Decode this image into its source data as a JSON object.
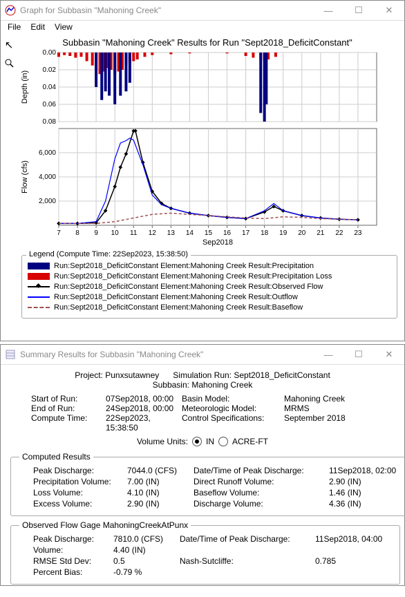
{
  "graph_window": {
    "title": "Graph for Subbasin \"Mahoning Creek\"",
    "menu": {
      "file": "File",
      "edit": "Edit",
      "view": "View"
    },
    "chart_title": "Subbasin \"Mahoning Creek\" Results for Run \"Sept2018_DeficitConstant\"",
    "y1_label": "Depth (in)",
    "y2_label": "Flow (cfs)",
    "x_label": "Sep2018",
    "legend_title": "Legend (Compute Time: 22Sep2023, 15:38:50)",
    "legend": {
      "precip": "Run:Sept2018_DeficitConstant Element:Mahoning Creek Result:Precipitation",
      "precip_loss": "Run:Sept2018_DeficitConstant Element:Mahoning Creek Result:Precipitation Loss",
      "observed": "Run:Sept2018_DeficitConstant Element:Mahoning Creek Result:Observed Flow",
      "outflow": "Run:Sept2018_DeficitConstant Element:Mahoning Creek Result:Outflow",
      "baseflow": "Run:Sept2018_DeficitConstant Element:Mahoning Creek Result:Baseflow"
    }
  },
  "summary_window": {
    "title": "Summary Results for Subbasin \"Mahoning Creek\"",
    "project_lbl": "Project:",
    "project": "Punxsutawney",
    "simrun_lbl": "Simulation Run:",
    "simrun": "Sept2018_DeficitConstant",
    "subbasin_lbl": "Subbasin:",
    "subbasin": "Mahoning Creek",
    "start_lbl": "Start of Run:",
    "start": "07Sep2018, 00:00",
    "end_lbl": "End of Run:",
    "end": "24Sep2018, 00:00",
    "ctime_lbl": "Compute Time:",
    "ctime": "22Sep2023, 15:38:50",
    "basin_lbl": "Basin Model:",
    "basin": "Mahoning Creek",
    "met_lbl": "Meteorologic Model:",
    "met": "MRMS",
    "ctrl_lbl": "Control Specifications:",
    "ctrl": "September 2018",
    "vol_label": "Volume Units:",
    "vol_in": "IN",
    "vol_acft": "ACRE-FT",
    "computed_title": "Computed Results",
    "observed_title": "Observed Flow Gage MahoningCreekAtPunx",
    "computed": {
      "peak_lbl": "Peak Discharge:",
      "peak": "7044.0 (CFS)",
      "pvol_lbl": "Precipitation Volume:",
      "pvol": "7.00 (IN)",
      "loss_lbl": "Loss Volume:",
      "loss": "4.10 (IN)",
      "excess_lbl": "Excess Volume:",
      "excess": "2.90 (IN)",
      "dtp_lbl": "Date/Time of Peak Discharge:",
      "dtp": "11Sep2018, 02:00",
      "dro_lbl": "Direct Runoff Volume:",
      "dro": "2.90 (IN)",
      "bfv_lbl": "Baseflow Volume:",
      "bfv": "1.46 (IN)",
      "dv_lbl": "Discharge Volume:",
      "dv": "4.36 (IN)"
    },
    "observed": {
      "peak_lbl": "Peak Discharge:",
      "peak": "7810.0 (CFS)",
      "vol_lbl": "Volume:",
      "vol": "4.40 (IN)",
      "rmse_lbl": "RMSE Std Dev:",
      "rmse": "0.5",
      "pb_lbl": "Percent Bias:",
      "pb": "-0.79 %",
      "dtp_lbl": "Date/Time of Peak Discharge:",
      "dtp": "11Sep2018, 04:00",
      "ns_lbl": "Nash-Sutcliffe:",
      "ns": "0.785"
    }
  },
  "chart_data": [
    {
      "type": "bar",
      "title": "Precipitation / Loss (inverted)",
      "xlabel": "Sep2018",
      "ylabel": "Depth (in)",
      "ylim": [
        0,
        0.08
      ],
      "y_ticks": [
        0.0,
        0.02,
        0.04,
        0.06,
        0.08
      ],
      "x_ticks": [
        7,
        8,
        9,
        10,
        11,
        12,
        13,
        14,
        15,
        16,
        17,
        18,
        19,
        20,
        21,
        22,
        23
      ],
      "series": [
        {
          "name": "Precipitation Loss",
          "color": "#d80000",
          "x": [
            7.0,
            7.3,
            7.6,
            7.9,
            8.2,
            8.5,
            8.8,
            9.0,
            9.2,
            9.4,
            9.6,
            9.8,
            10.0,
            10.2,
            10.4,
            10.6,
            10.8,
            11.0,
            11.2,
            11.6,
            12.0,
            13.0,
            14.0,
            16.0,
            17.0,
            17.4,
            17.8,
            18.0,
            18.2,
            18.6
          ],
          "values": [
            0.005,
            0.003,
            0.004,
            0.006,
            0.005,
            0.01,
            0.015,
            0.02,
            0.025,
            0.022,
            0.018,
            0.02,
            0.025,
            0.022,
            0.02,
            0.015,
            0.012,
            0.01,
            0.008,
            0.005,
            0.003,
            0.002,
            0.001,
            0.001,
            0.004,
            0.006,
            0.008,
            0.01,
            0.008,
            0.005
          ]
        },
        {
          "name": "Precipitation",
          "color": "#000080",
          "x": [
            9.0,
            9.3,
            9.5,
            9.7,
            10.0,
            10.3,
            10.6,
            10.8,
            17.8,
            18.0,
            18.1
          ],
          "values": [
            0.04,
            0.055,
            0.045,
            0.05,
            0.06,
            0.05,
            0.045,
            0.035,
            0.07,
            0.08,
            0.06
          ]
        }
      ]
    },
    {
      "type": "line",
      "title": "Flow",
      "xlabel": "Sep2018",
      "ylabel": "Flow (cfs)",
      "ylim": [
        0,
        8000
      ],
      "y_ticks": [
        2000,
        4000,
        6000
      ],
      "x_ticks": [
        7,
        8,
        9,
        10,
        11,
        12,
        13,
        14,
        15,
        16,
        17,
        18,
        19,
        20,
        21,
        22,
        23
      ],
      "series": [
        {
          "name": "Observed Flow",
          "color": "#000000",
          "x": [
            7,
            8,
            9,
            9.5,
            10,
            10.3,
            10.6,
            11,
            11.1,
            11.5,
            12,
            12.5,
            13,
            14,
            15,
            16,
            17,
            18,
            18.5,
            19,
            20,
            21,
            22,
            23
          ],
          "values": [
            150,
            150,
            200,
            1200,
            3200,
            4800,
            5900,
            7800,
            7810,
            5200,
            2800,
            1800,
            1400,
            1000,
            800,
            650,
            550,
            1100,
            1550,
            1200,
            800,
            600,
            500,
            450
          ]
        },
        {
          "name": "Outflow",
          "color": "#0000ff",
          "x": [
            7,
            8,
            9,
            9.5,
            10,
            10.3,
            10.6,
            10.8,
            11,
            11.5,
            12,
            12.5,
            13,
            14,
            15,
            16,
            17,
            18,
            18.5,
            19,
            20,
            21,
            22,
            23
          ],
          "values": [
            150,
            150,
            300,
            2000,
            5500,
            6800,
            7000,
            7200,
            7044,
            5000,
            2500,
            1700,
            1400,
            1000,
            800,
            650,
            550,
            1200,
            1800,
            1200,
            800,
            600,
            500,
            450
          ]
        },
        {
          "name": "Baseflow",
          "color": "#a05050",
          "x": [
            7,
            8,
            9,
            10,
            11,
            12,
            13,
            14,
            15,
            16,
            17,
            18,
            19,
            20,
            21,
            22,
            23
          ],
          "values": [
            150,
            150,
            150,
            300,
            600,
            900,
            1000,
            900,
            800,
            700,
            600,
            550,
            700,
            650,
            550,
            500,
            450
          ]
        }
      ]
    }
  ]
}
